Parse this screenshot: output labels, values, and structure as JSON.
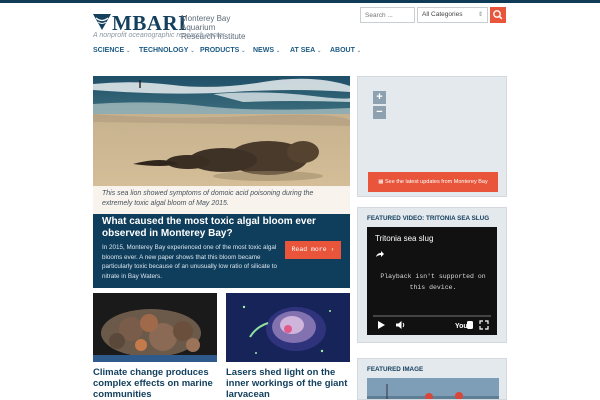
{
  "site": {
    "logo_text": "MBARI",
    "logo_sub_1": "Monterey Bay Aquarium",
    "logo_sub_2": "Research Institute",
    "tagline": "A nonprofit oceanographic research center"
  },
  "search": {
    "placeholder": "Search ...",
    "category": "All Categories",
    "button_icon": "search-icon"
  },
  "nav": {
    "items": [
      {
        "label": "SCIENCE"
      },
      {
        "label": "TECHNOLOGY"
      },
      {
        "label": "PRODUCTS"
      },
      {
        "label": "NEWS"
      },
      {
        "label": "AT SEA"
      },
      {
        "label": "ABOUT"
      }
    ]
  },
  "hero": {
    "caption": "This sea lion showed symptoms of domoic acid poisoning during the extremely toxic algal bloom of May 2015.",
    "title": "What caused the most toxic algal bloom ever observed in Monterey Bay?",
    "body": "In 2015, Monterey Bay experienced one of the most toxic algal blooms ever. A new paper shows that this bloom became particularly toxic because of an unusually low ratio of silicate to nitrate in Bay Waters.",
    "button": "Read more ›"
  },
  "cards": [
    {
      "title": "Climate change produces complex effects on marine communities"
    },
    {
      "title": "Lasers shed light on the inner workings of the giant larvacean"
    }
  ],
  "map": {
    "zoom_in": "+",
    "zoom_out": "−",
    "button": "See the latest updates from Monterey Bay"
  },
  "video": {
    "heading": "FEATURED VIDEO: TRITONIA SEA SLUG",
    "title": "Tritonia sea slug",
    "message": "Playback isn't supported on this device."
  },
  "featured_image": {
    "heading": "FEATURED IMAGE"
  },
  "colors": {
    "brand_navy": "#14405e",
    "accent_orange": "#e8553a",
    "link_blue": "#1c5a84"
  }
}
